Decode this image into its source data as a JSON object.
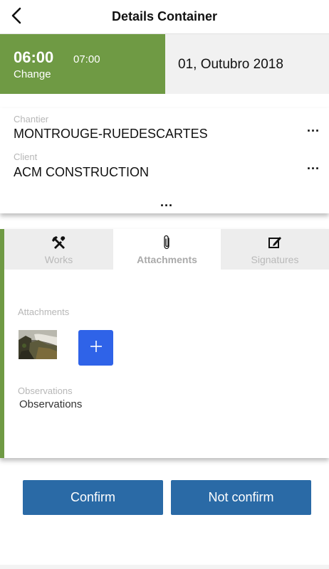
{
  "header": {
    "title": "Details Container",
    "back_icon": "chevron-left-icon"
  },
  "schedule": {
    "start_time": "06:00",
    "end_time": "07:00",
    "change_label": "Change",
    "date": "01, Outubro 2018",
    "accent_color": "#6f9a44"
  },
  "info": {
    "chantier_label": "Chantier",
    "chantier_value": "MONTROUGE-RUEDESCARTES",
    "client_label": "Client",
    "client_value": "ACM CONSTRUCTION",
    "more_label": "..."
  },
  "tabs": [
    {
      "label": "Works",
      "icon": "tools-icon",
      "active": false
    },
    {
      "label": "Attachments",
      "icon": "paperclip-icon",
      "active": true
    },
    {
      "label": "Signatures",
      "icon": "signature-icon",
      "active": false
    }
  ],
  "attachments": {
    "section_label": "Attachments",
    "add_icon": "plus-icon",
    "add_color": "#2f63e8"
  },
  "observations": {
    "label": "Observations",
    "value": "Observations"
  },
  "actions": {
    "confirm_label": "Confirm",
    "not_confirm_label": "Not confirm",
    "color": "#2a6aa6"
  }
}
